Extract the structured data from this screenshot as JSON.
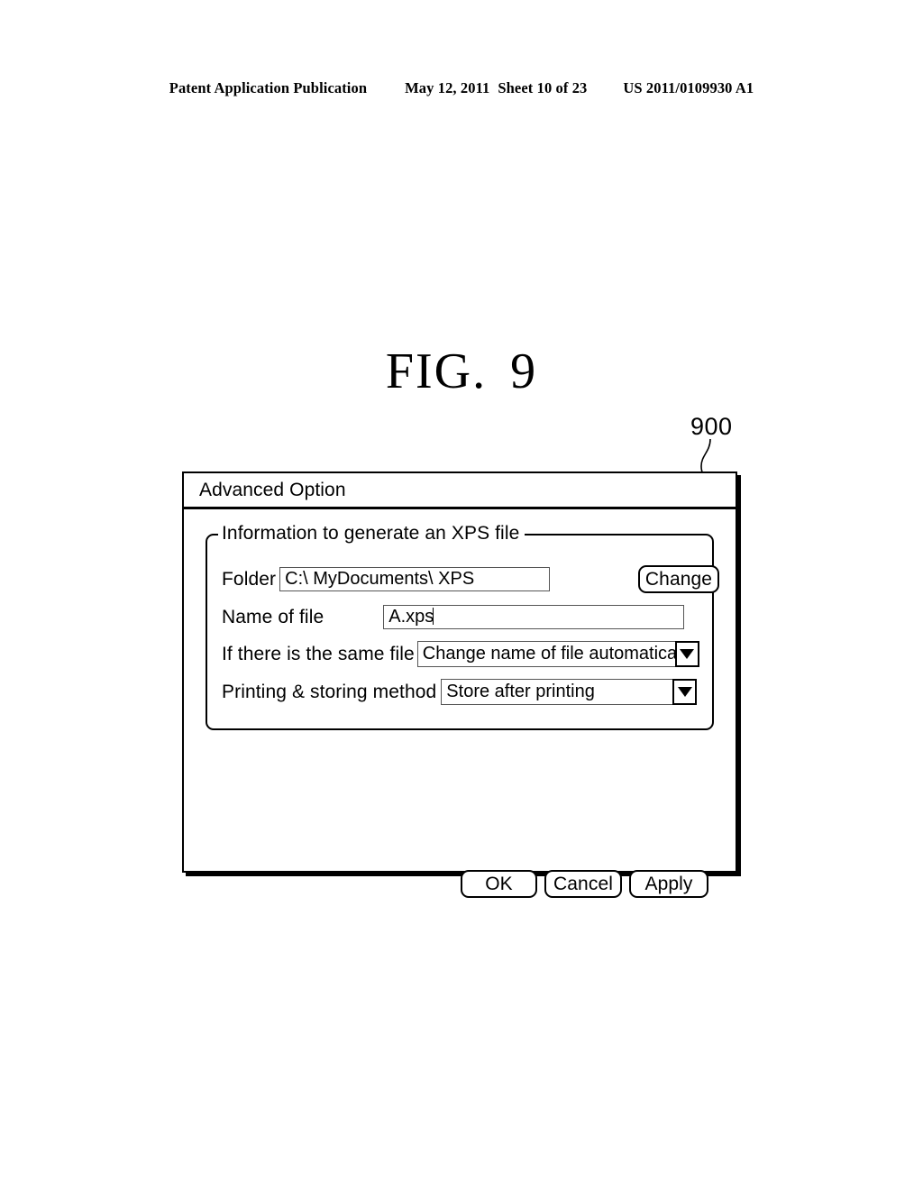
{
  "page_header": {
    "publication": "Patent Application Publication",
    "date": "May 12, 2011",
    "sheet": "Sheet 10 of 23",
    "patent_number": "US 2011/0109930 A1"
  },
  "figure": {
    "label": "FIG.",
    "number": "9",
    "reference_numeral": "900"
  },
  "dialog": {
    "title": "Advanced Option",
    "groupbox": {
      "legend": "Information to generate an XPS file",
      "rows": [
        {
          "label": "Folder",
          "type": "textbox",
          "value": "C:\\ MyDocuments\\ XPS",
          "button": "Change"
        },
        {
          "label": "Name of file",
          "type": "textbox",
          "value": "A.xps"
        },
        {
          "label": "If there is the same file",
          "type": "combobox",
          "value": "Change name of file automatically"
        },
        {
          "label": "Printing & storing method",
          "type": "combobox",
          "value": "Store after printing"
        }
      ]
    },
    "buttons": {
      "ok": "OK",
      "cancel": "Cancel",
      "apply": "Apply"
    }
  }
}
